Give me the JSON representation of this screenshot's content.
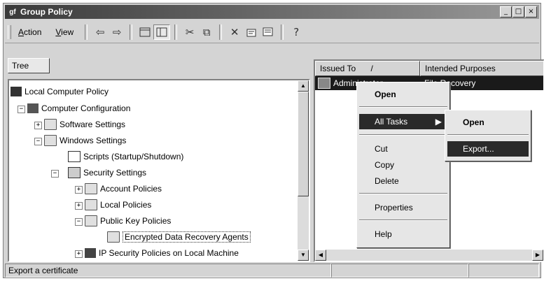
{
  "window": {
    "title": "Group Policy",
    "app_icon": "gpo-icon",
    "minimize": "_",
    "maximize": "□",
    "close": "×"
  },
  "menu": {
    "action_first": "A",
    "action_rest": "ction",
    "view_first": "V",
    "view_rest": "iew"
  },
  "toolbar": {
    "icons": [
      "back-icon",
      "forward-icon",
      "up-icon",
      "show-hide-tree-icon",
      "cut-icon",
      "copy-icon",
      "delete-icon",
      "properties-icon",
      "export-list-icon",
      "help-icon"
    ]
  },
  "tree_tab": "Tree",
  "tree": [
    {
      "label": "Local Computer Policy",
      "icon": "policy-icon"
    },
    {
      "label": "Computer Configuration",
      "icon": "computer-icon",
      "expander": "−"
    },
    {
      "label": "Software Settings",
      "icon": "folder-icon",
      "expander": "+"
    },
    {
      "label": "Windows Settings",
      "icon": "folder-icon",
      "expander": "−"
    },
    {
      "label": "Scripts (Startup/Shutdown)",
      "icon": "script-icon"
    },
    {
      "label": "Security Settings",
      "icon": "security-icon",
      "expander": "−"
    },
    {
      "label": "Account Policies",
      "icon": "folder-lock-icon",
      "expander": "+"
    },
    {
      "label": "Local Policies",
      "icon": "folder-lock-icon",
      "expander": "+"
    },
    {
      "label": "Public Key Policies",
      "icon": "folder-icon",
      "expander": "−"
    },
    {
      "label": "Encrypted Data Recovery Agents",
      "icon": "folder-open-icon",
      "selected": true
    },
    {
      "label": "IP Security Policies on Local Machine",
      "icon": "network-icon",
      "expander": "+"
    }
  ],
  "list": {
    "columns": [
      "Issued To",
      "Intended Purposes"
    ],
    "sort_mark": "/",
    "row": {
      "issued_to": "Administrator",
      "purpose": "File Recovery"
    }
  },
  "context_menu": [
    {
      "label": "Open",
      "bold": true
    },
    {
      "label": "All Tasks",
      "submenu": true,
      "highlighted": true
    },
    {
      "label": "Cut"
    },
    {
      "label": "Copy"
    },
    {
      "label": "Delete"
    },
    {
      "label": "Properties"
    },
    {
      "label": "Help"
    }
  ],
  "submenu": [
    {
      "label": "Open",
      "bold": true
    },
    {
      "label": "Export...",
      "highlighted": true
    }
  ],
  "status": {
    "text": "Export a certificate"
  }
}
